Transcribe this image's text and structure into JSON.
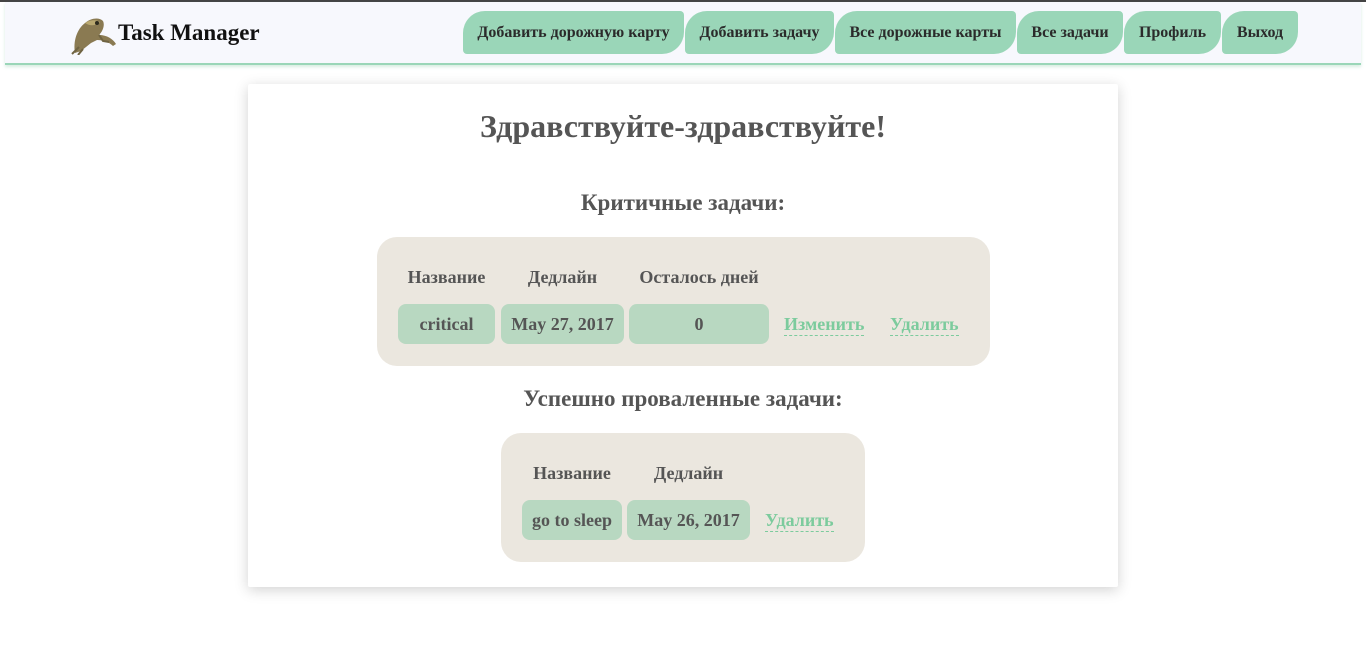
{
  "header": {
    "brand": "Task Manager",
    "logo_icon": "frog-logo-icon",
    "nav": [
      "Добавить дорожную карту",
      "Добавить задачу",
      "Все дорожные карты",
      "Все задачи",
      "Профиль",
      "Выход"
    ]
  },
  "main": {
    "greeting": "Здравствуйте-здравствуйте!",
    "critical": {
      "title": "Критичные задачи:",
      "columns": [
        "Название",
        "Дедлайн",
        "Осталось дней"
      ],
      "rows": [
        {
          "name": "critical",
          "deadline": "May 27, 2017",
          "days_left": "0",
          "edit": "Изменить",
          "delete": "Удалить"
        }
      ]
    },
    "failed": {
      "title": "Успешно проваленные задачи:",
      "columns": [
        "Название",
        "Дедлайн"
      ],
      "rows": [
        {
          "name": "go to sleep",
          "deadline": "May 26, 2017",
          "delete": "Удалить"
        }
      ]
    }
  },
  "colors": {
    "accent": "#9ad6b8",
    "cell": "#b8d8c1",
    "panel": "#ebe7df",
    "link": "#7ccb9d",
    "text": "#555555"
  }
}
